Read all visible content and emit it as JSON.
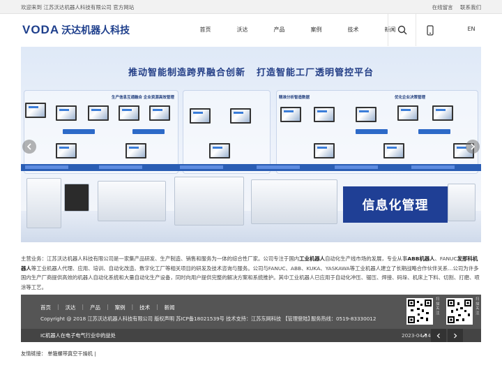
{
  "topbar": {
    "welcome": "欢迎来到 江苏沃达机器人科技有限公司 官方网站",
    "links": [
      "在线留言",
      "联系我们"
    ]
  },
  "header": {
    "logo_mark": "VODA",
    "logo_text": "沃达机器人科技",
    "nav": [
      "首页",
      "沃达",
      "产品",
      "案例",
      "技术",
      "新闻"
    ],
    "icons": [
      "search-icon",
      "mobile-icon"
    ],
    "lang": "EN"
  },
  "banner": {
    "headline_left": "推动智能制造跨界融合创新",
    "headline_right": "打造智能工厂透明管控平台",
    "panel_titles": [
      "生产信息互通融合 企业资源高效管理",
      "精准分析智造数据",
      "优化企业决策管理"
    ],
    "badge": "信息化管理",
    "accent": "#1f3f95"
  },
  "intro": {
    "p1": "主营业务：江苏沃达机器人科技有限公司是一家集产品研发、生产制造、销售和服务为一体的综合性厂家。公司专注于国内",
    "k1": "工业机器人",
    "p2": "自动化生产线市场的发展，专业从事",
    "k2": "ABB机器人",
    "p3": "、FANUC",
    "k3": "发那科机器人",
    "p4": "等工业机器人代理、应用、培训、自动化改造、数字化工厂等相关项目的研发及技术咨询与服务。公司与FANUC、ABB、KUKA、YASKAWA等工业机器人建立了长期战略合作伙伴关系…公司为许多国内生产厂商提供高效的机器人自动化系统和大量自动化生产设备，同时向用户提供完整的解决方案和系统推护。其中工业机器人已应用于自动化冲压、锯压、焊接、码垛、机床上下料、切割、打磨、喷涂等工艺。"
  },
  "footer": {
    "nav": [
      "首页",
      "沃达",
      "产品",
      "案例",
      "技术",
      "新闻"
    ],
    "copyright": "Copyright @ 2018 江苏沃达机器人科技有限公司 版权声明 苏ICP备18021539号 技术支持：江苏东网科技 【管理登陆】",
    "phone": "服务热线：0519-83330012",
    "qr_labels": [
      "扫描关注",
      "扫描关注"
    ],
    "news_item": "IC机器人在电子电气行业中的益处",
    "news_date": "2023-04-14"
  },
  "friend": {
    "label": "友情链接：",
    "link": "单箍螺带真空干燥机 |"
  }
}
